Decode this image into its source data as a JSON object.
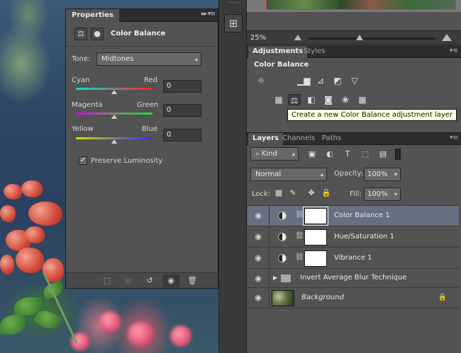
{
  "properties_panel": {
    "tab_label": "Properties",
    "collapse_glyph": "▸▸",
    "menu_glyph": "≡",
    "adjustment_name": "Color Balance",
    "tone_label": "Tone:",
    "tone_value": "Midtones",
    "sliders": [
      {
        "left": "Cyan",
        "right": "Red",
        "value": "0",
        "level": 0.5
      },
      {
        "left": "Magenta",
        "right": "Green",
        "value": "0",
        "level": 0.5
      },
      {
        "left": "Yellow",
        "right": "Blue",
        "value": "0",
        "level": 0.5
      }
    ],
    "preserve_luminosity_label": "Preserve Luminosity",
    "preserve_luminosity_checked": true,
    "footer_icons": [
      "clip-to-layer-icon",
      "view-previous-state-icon",
      "reset-icon",
      "toggle-visibility-icon",
      "delete-icon"
    ]
  },
  "canvas": {
    "zoom": "25%"
  },
  "adjustments_panel": {
    "tabs": [
      "Adjustments",
      "Styles"
    ],
    "title": "Color Balance",
    "row1_icons": [
      "brightness-contrast-icon",
      "levels-icon",
      "curves-icon",
      "exposure-icon",
      "vibrance-icon"
    ],
    "row2_icons": [
      "hue-saturation-icon",
      "color-balance-icon",
      "black-white-icon",
      "photo-filter-icon",
      "channel-mixer-icon",
      "color-lookup-icon"
    ],
    "tooltip": "Create a new Color Balance adjustment layer"
  },
  "layers_panel": {
    "tabs": [
      "Layers",
      "Channels",
      "Paths"
    ],
    "filter_kind": "Kind",
    "blend_mode": "Normal",
    "opacity_label": "Opacity:",
    "opacity_value": "100%",
    "lock_label": "Lock:",
    "fill_label": "Fill:",
    "fill_value": "100%",
    "layers": [
      {
        "name": "Color Balance 1",
        "selected": true
      },
      {
        "name": "Hue/Saturation 1",
        "selected": false
      },
      {
        "name": "Vibrance 1",
        "selected": false
      },
      {
        "name": "Invert Average Blur Technique",
        "selected": false
      },
      {
        "name": "Background",
        "selected": false
      }
    ]
  }
}
